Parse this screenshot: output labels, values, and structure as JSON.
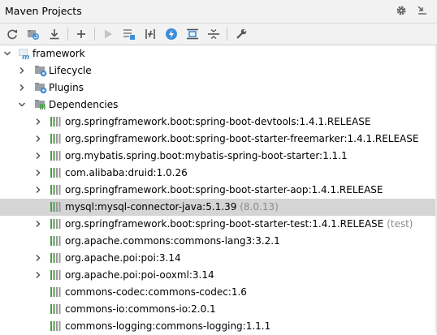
{
  "panel": {
    "title": "Maven Projects"
  },
  "toolbar": {
    "buttons": [
      {
        "icon": "reimport-icon"
      },
      {
        "icon": "generate-sources-icon"
      },
      {
        "icon": "download-icon"
      },
      {
        "icon": "add-icon"
      },
      {
        "icon": "run-icon"
      },
      {
        "icon": "execute-goal-icon"
      },
      {
        "icon": "toggle-offline-icon"
      },
      {
        "icon": "skip-tests-icon"
      },
      {
        "icon": "show-dependencies-icon"
      },
      {
        "icon": "collapse-all-icon"
      },
      {
        "icon": "settings-wrench-icon"
      }
    ]
  },
  "tree": {
    "root": "framework",
    "lifecycle": "Lifecycle",
    "plugins": "Plugins",
    "dependencies": "Dependencies",
    "deps": [
      {
        "label": "org.springframework.boot:spring-boot-devtools:1.4.1.RELEASE",
        "extra": "",
        "expandable": true
      },
      {
        "label": "org.springframework.boot:spring-boot-starter-freemarker:1.4.1.RELEASE",
        "extra": "",
        "expandable": true
      },
      {
        "label": "org.mybatis.spring.boot:mybatis-spring-boot-starter:1.1.1",
        "extra": "",
        "expandable": true
      },
      {
        "label": "com.alibaba:druid:1.0.26",
        "extra": "",
        "expandable": true
      },
      {
        "label": "org.springframework.boot:spring-boot-starter-aop:1.4.1.RELEASE",
        "extra": "",
        "expandable": true
      },
      {
        "label": "mysql:mysql-connector-java:5.1.39",
        "extra": "(8.0.13)",
        "expandable": false,
        "selected": true
      },
      {
        "label": "org.springframework.boot:spring-boot-starter-test:1.4.1.RELEASE",
        "extra": "(test)",
        "expandable": true
      },
      {
        "label": "org.apache.commons:commons-lang3:3.2.1",
        "extra": "",
        "expandable": false
      },
      {
        "label": "org.apache.poi:poi:3.14",
        "extra": "",
        "expandable": true
      },
      {
        "label": "org.apache.poi:poi-ooxml:3.14",
        "extra": "",
        "expandable": true
      },
      {
        "label": "commons-codec:commons-codec:1.6",
        "extra": "",
        "expandable": false
      },
      {
        "label": "commons-io:commons-io:2.0.1",
        "extra": "",
        "expandable": false
      },
      {
        "label": "commons-logging:commons-logging:1.1.1",
        "extra": "",
        "expandable": false
      }
    ]
  },
  "colors": {
    "library_green": "#4f9a4a",
    "maven_blue": "#3d8ed9",
    "selection": "#d5d5d5"
  }
}
